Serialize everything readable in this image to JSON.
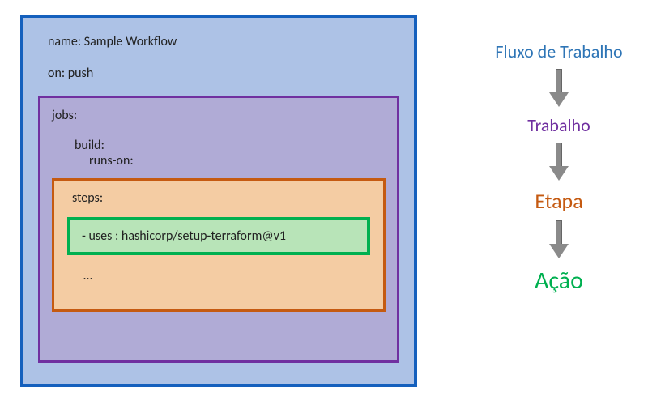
{
  "workflow": {
    "name_line": "name: Sample Workflow",
    "on_line": "on: push"
  },
  "jobs": {
    "label": "jobs:",
    "build_label": "build:",
    "runs_on_label": "runs-on:"
  },
  "steps": {
    "label": "steps:",
    "dots": "…"
  },
  "action": {
    "uses_line": "- uses : hashicorp/setup-terraform@v1"
  },
  "legend": {
    "workflow": "Fluxo de Trabalho",
    "job": "Trabalho",
    "step": "Etapa",
    "action": "Ação"
  }
}
